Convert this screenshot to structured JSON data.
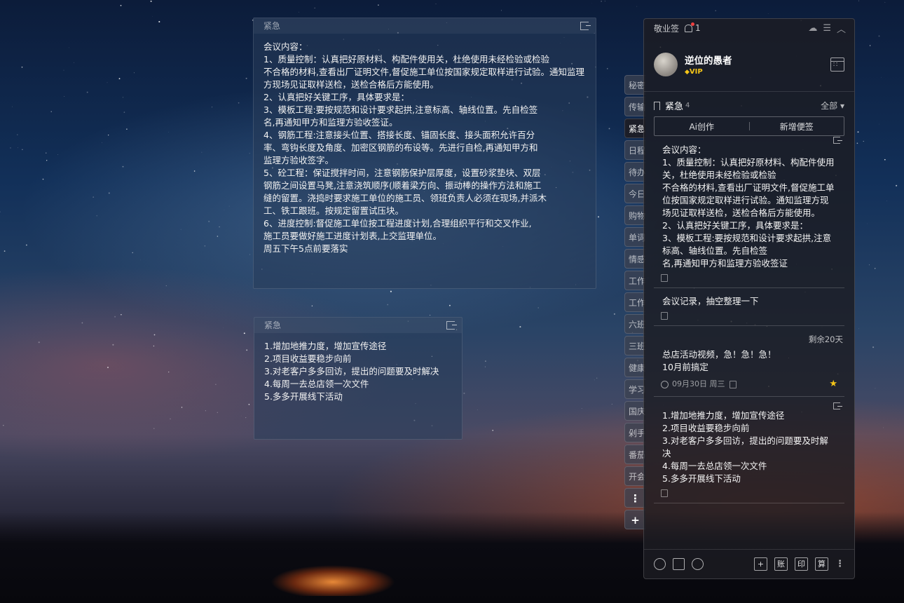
{
  "note_large": {
    "header": "紧急",
    "content": "会议内容：\n1、质量控制：认真把好原材料、构配件使用关，杜绝使用未经检验或检验\n不合格的材料,查看出厂证明文件,督促施工单位按国家规定取样进行试验。通知监理\n方现场见证取样送检，送检合格后方能使用。\n2、认真把好关键工序，具体要求是：\n3、模板工程:要按规范和设计要求起拱,注意标高、轴线位置。先自检签\n名,再通知甲方和监理方验收签证。\n4、钢筋工程:注意接头位置、搭接长度、锚固长度、接头面积允许百分\n率、弯钩长度及角度、加密区钢筋的布设等。先进行自检,再通知甲方和\n监理方验收签字。\n5、砼工程：保证搅拌时间，注意钢筋保护层厚度，设置砂浆垫块、双层\n钢筋之间设置马凳,注意浇筑顺序(顺着梁方向、振动棒的操作方法和施工\n缝的留置。浇捣时要求施工单位的施工员、领班负责人必须在现场,并派木\n工、铁工跟班。按规定留置试压块。\n6、进度控制:督促施工单位按工程进度计划,合理组织平行和交叉作业,\n施工员要做好施工进度计划表,上交监理单位。\n周五下午5点前要落实"
  },
  "note_small": {
    "header": "紧急",
    "content": "1.增加地推力度，增加宣传途径\n2.项目收益要稳步向前\n3.对老客户多多回访，提出的问题要及时解决\n4.每周一去总店领一次文件\n5.多多开展线下活动"
  },
  "side_tabs": [
    "秘密",
    "传输",
    "紧急",
    "日程",
    "待办",
    "今日",
    "购物",
    "单词",
    "情感",
    "工作",
    "工作",
    "六班",
    "三班",
    "健康",
    "学习",
    "国庆",
    "剁手",
    "番茄",
    "开会"
  ],
  "side_tabs_more": "⋮",
  "side_tabs_add": "+",
  "panel": {
    "app_name": "敬业签",
    "notification_count": "1",
    "user_name": "逆位的愚者",
    "vip_label": "VIP",
    "category": "紧急",
    "category_count": "4",
    "filter": "全部",
    "ai_button": "Ai创作",
    "new_button": "新增便签",
    "items": [
      {
        "content": "会议内容：\n1、质量控制：认真把好原材料、构配件使用关，杜绝使用未经检验或检验\n不合格的材料,查看出厂证明文件,督促施工单位按国家规定取样进行试验。通知监理方现场见证取样送检，送检合格后方能使用。\n2、认真把好关键工序，具体要求是：\n3、模板工程:要按规范和设计要求起拱,注意标高、轴线位置。先自检签\n名,再通知甲方和监理方验收签证"
      },
      {
        "content": "会议记录，抽空整理一下"
      },
      {
        "remaining": "剩余20天",
        "content": "总店活动视频，急！急！急！\n10月前搞定",
        "date": "09月30日 周三"
      },
      {
        "content": "1.增加地推力度，增加宣传途径\n2.项目收益要稳步向前\n3.对老客户多多回访，提出的问题要及时解决\n4.每周一去总店领一次文件\n5.多多开展线下活动"
      }
    ],
    "footer": {
      "add": "+",
      "ledger": "账",
      "print": "印",
      "calc": "算",
      "more": "⋮"
    }
  },
  "colors": {
    "star": "#f5c518",
    "notification_dot": "#f04040"
  }
}
